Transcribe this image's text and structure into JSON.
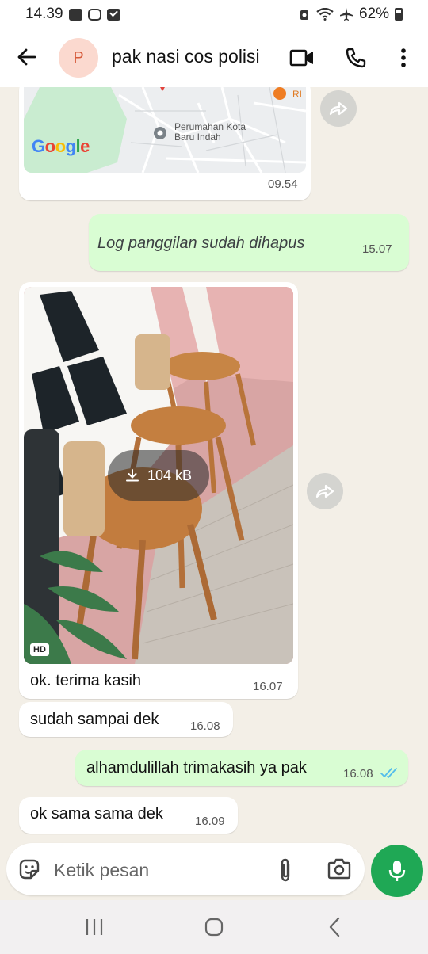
{
  "status_bar": {
    "time": "14.39",
    "battery": "62%"
  },
  "header": {
    "avatar_letter": "P",
    "contact_name": "pak nasi cos polisi"
  },
  "map_card": {
    "attribution": "Google",
    "place_label_line1": "Perumahan Kota",
    "place_label_line2": "Baru Indah",
    "poi_label": "RI",
    "time": "09.54"
  },
  "messages": [
    {
      "direction": "outgoing",
      "text": "Log panggilan sudah dihapus",
      "time": "15.07",
      "style": "italic"
    },
    {
      "direction": "incoming",
      "type": "image",
      "download_size": "104 kB",
      "hd_badge": "HD",
      "caption": "ok. terima kasih",
      "time": "16.07"
    },
    {
      "direction": "incoming",
      "text": "sudah sampai dek",
      "time": "16.08"
    },
    {
      "direction": "outgoing",
      "text": "alhamdulillah trimakasih ya pak",
      "time": "16.08",
      "status": "read"
    },
    {
      "direction": "incoming",
      "text": "ok sama sama dek",
      "time": "16.09"
    }
  ],
  "composer": {
    "placeholder": "Ketik pesan"
  },
  "colors": {
    "outgoing_bubble": "#d9fdd3",
    "chat_background": "#f3efe7",
    "accent_green": "#1fa855",
    "read_tick": "#53bdeb"
  },
  "icons": [
    "back-arrow-icon",
    "video-call-icon",
    "phone-icon",
    "more-vert-icon",
    "forward-icon",
    "download-icon",
    "double-check-icon",
    "sticker-icon",
    "attach-icon",
    "camera-icon",
    "mic-icon",
    "recent-apps-icon",
    "home-icon",
    "back-nav-icon"
  ]
}
